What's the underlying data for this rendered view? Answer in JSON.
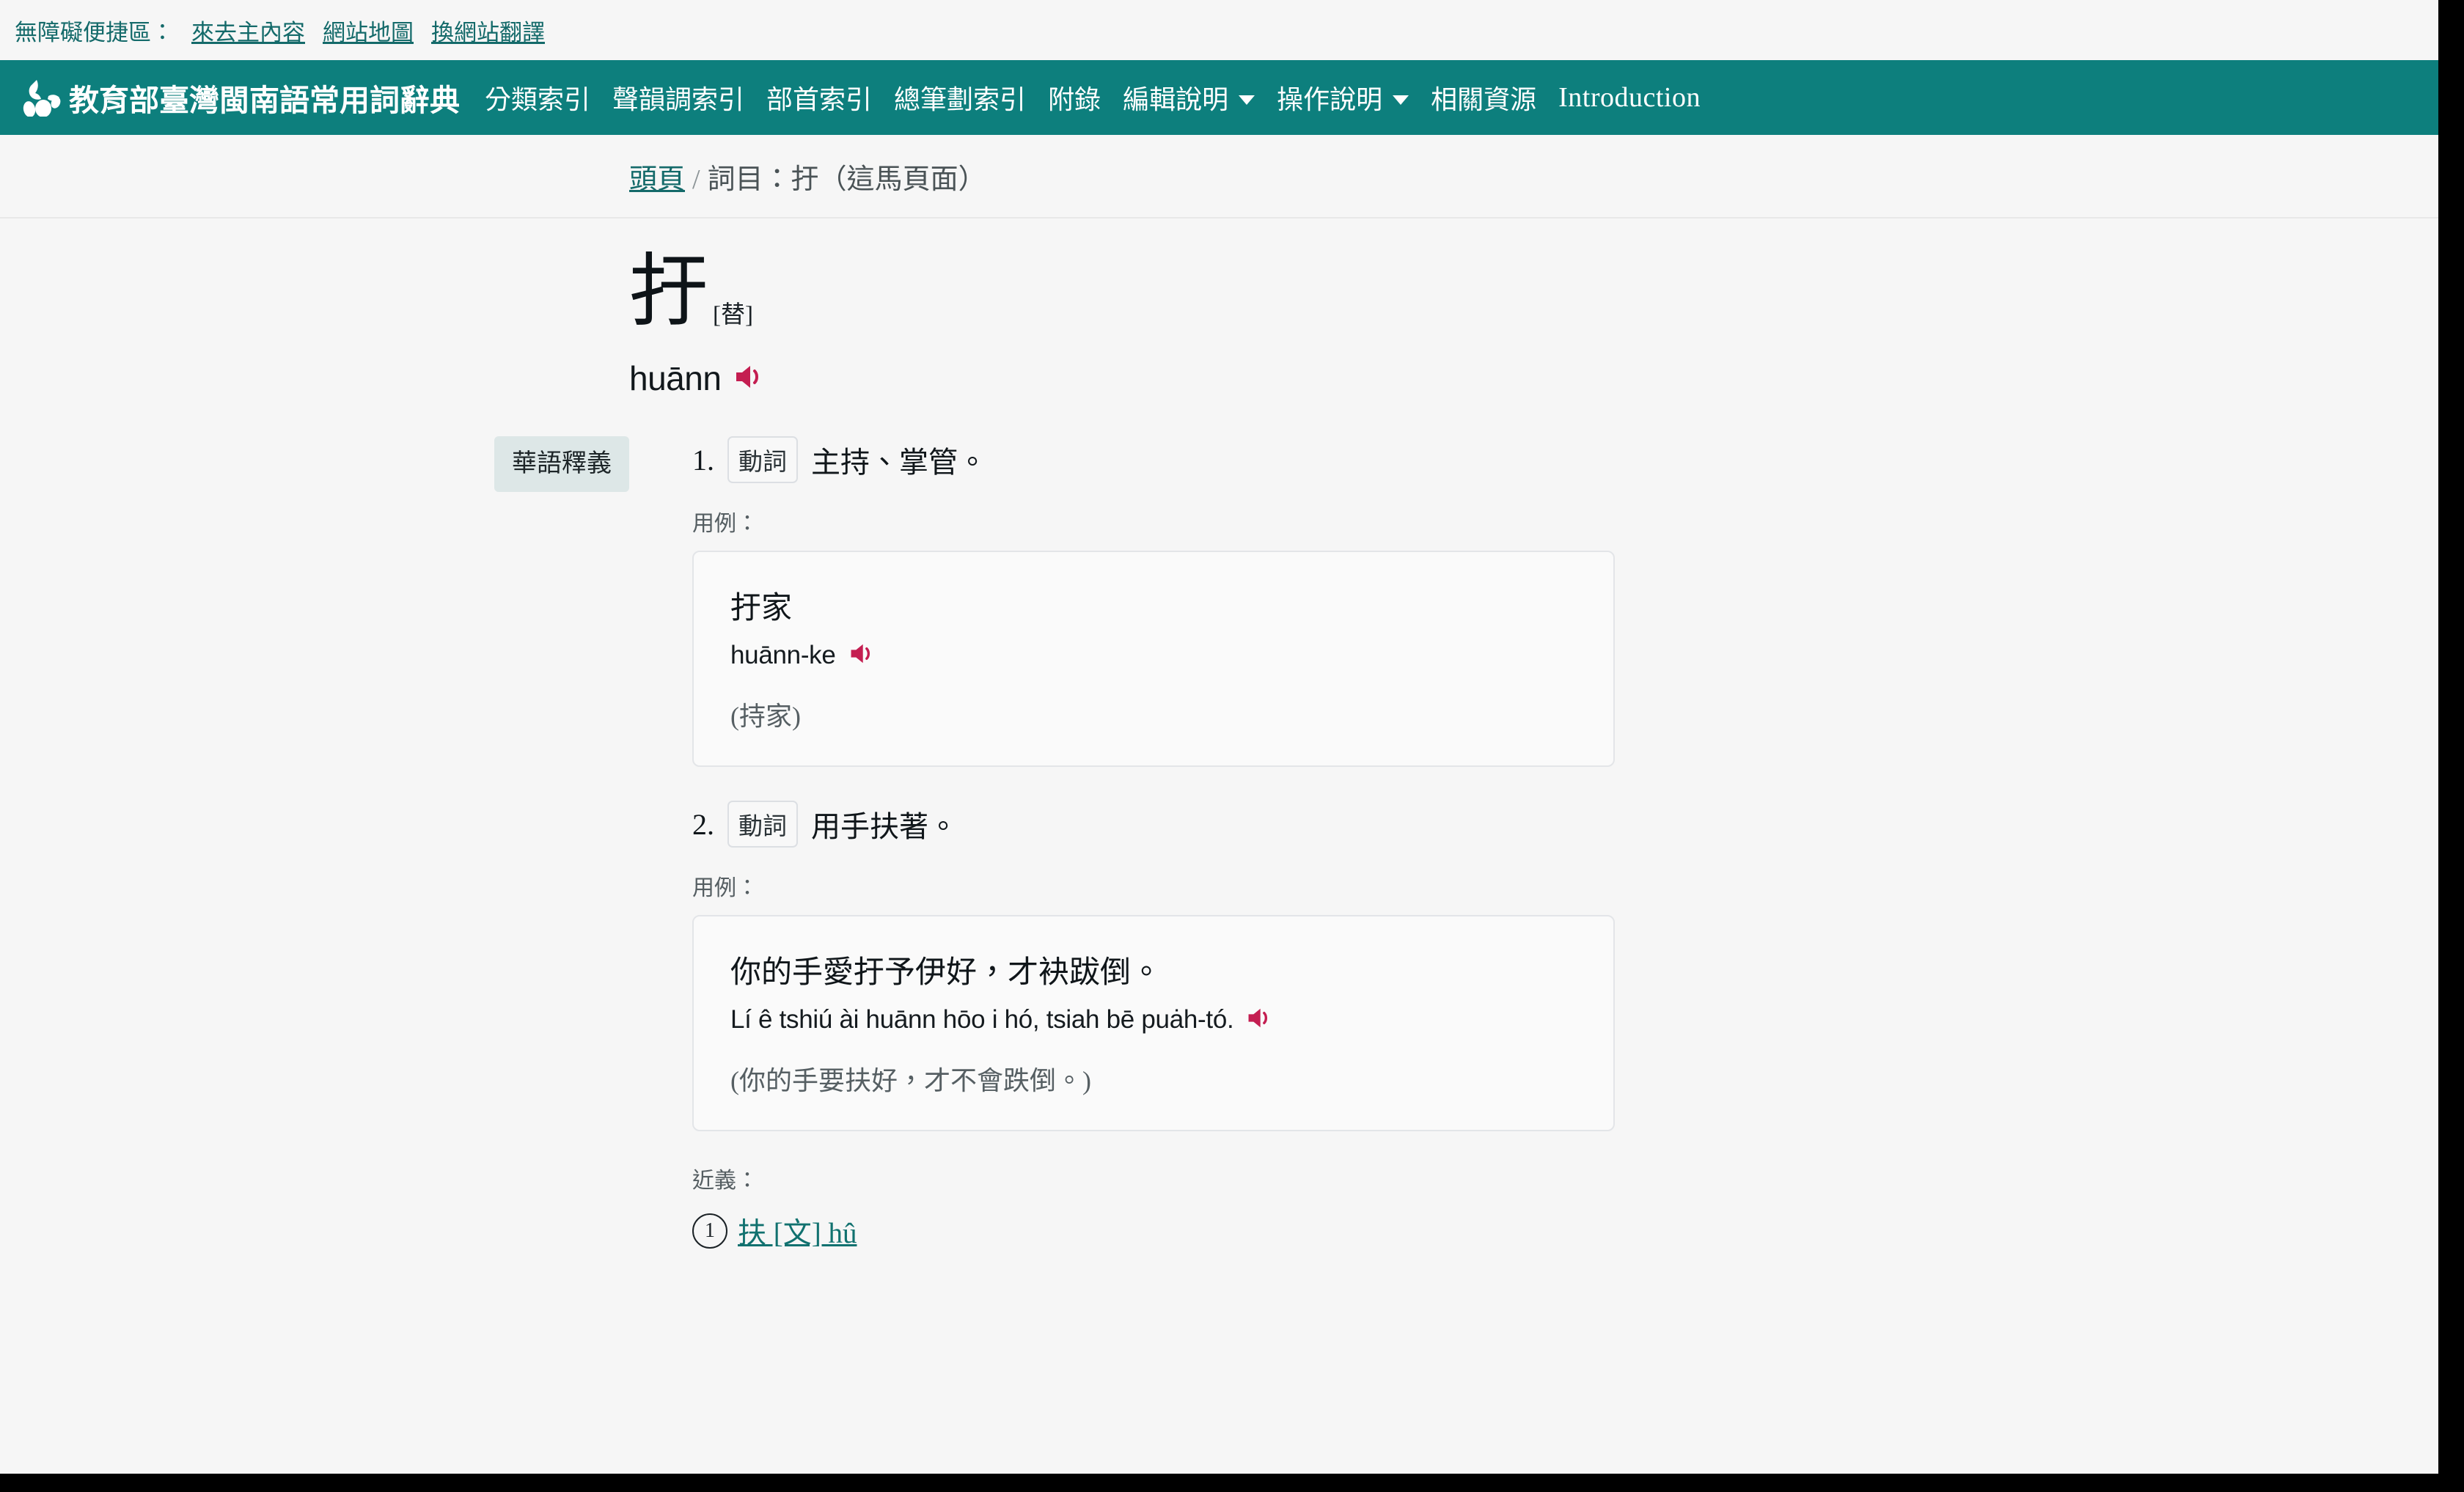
{
  "accessibility": {
    "label": "無障礙便捷區：",
    "links": [
      {
        "label": "來去主內容"
      },
      {
        "label": "網站地圖"
      },
      {
        "label": "換網站翻譯"
      }
    ]
  },
  "navbar": {
    "logo_icon": "flower-bird-logo-icon",
    "brand_title": "教育部臺灣閩南語常用詞辭典",
    "items": [
      {
        "label": "分類索引",
        "has_dropdown": false,
        "latin": false
      },
      {
        "label": "聲韻調索引",
        "has_dropdown": false,
        "latin": false
      },
      {
        "label": "部首索引",
        "has_dropdown": false,
        "latin": false
      },
      {
        "label": "總筆劃索引",
        "has_dropdown": false,
        "latin": false
      },
      {
        "label": "附錄",
        "has_dropdown": false,
        "latin": false
      },
      {
        "label": "編輯說明",
        "has_dropdown": true,
        "latin": false
      },
      {
        "label": "操作說明",
        "has_dropdown": true,
        "latin": false
      },
      {
        "label": "相關資源",
        "has_dropdown": false,
        "latin": false
      },
      {
        "label": "Introduction",
        "has_dropdown": false,
        "latin": true
      }
    ]
  },
  "breadcrumb": {
    "home_label": "頭頁",
    "separator": "/",
    "current": "詞目：扜（這馬頁面）"
  },
  "entry": {
    "headword": "扜",
    "headword_sup": "[替]",
    "romanization": "huānn",
    "audio_icon": "speaker-icon",
    "lang_tag": "華語釋義",
    "definitions": [
      {
        "number": "1.",
        "pos": "動詞",
        "text": "主持、掌管。",
        "example_label": "用例：",
        "example": {
          "han": "扜家",
          "romanization": "huānn-ke",
          "audio_icon": "speaker-icon",
          "gloss": "(持家)"
        }
      },
      {
        "number": "2.",
        "pos": "動詞",
        "text": "用手扶著。",
        "example_label": "用例：",
        "example": {
          "han": "你的手愛扜予伊好，才袂跋倒。",
          "romanization": "Lí ê tshiú ài huānn hōo i hó, tsiah bē puȧh-tó.",
          "audio_icon": "speaker-icon",
          "gloss": "(你的手要扶好，才不會跌倒。)"
        }
      }
    ],
    "synonym_label": "近義：",
    "synonyms": [
      {
        "index": "1",
        "label": "扶 [文] hû"
      }
    ]
  },
  "colors": {
    "brand_teal": "#0d7f7d",
    "link_teal": "#146a6a",
    "audio_crimson": "#c41e51",
    "page_bg": "#f6f6f6",
    "tag_bg": "#dde7e7"
  }
}
